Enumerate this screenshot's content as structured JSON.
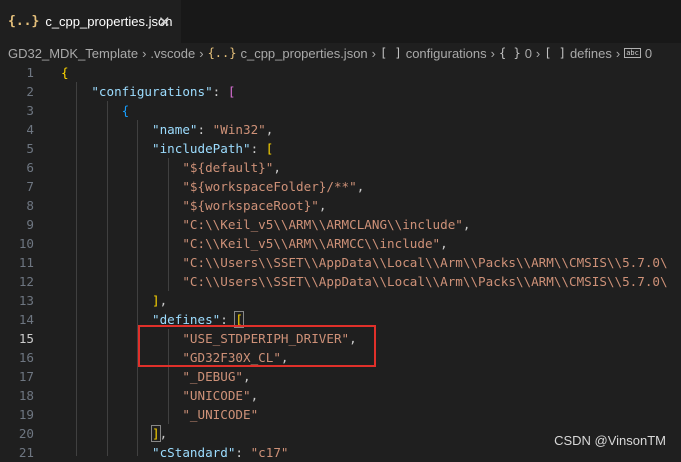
{
  "tab": {
    "icon": "{..}",
    "title": "c_cpp_properties.json",
    "close": "✕"
  },
  "breadcrumb": {
    "items": [
      {
        "icon": "",
        "label": "GD32_MDK_Template"
      },
      {
        "icon": "",
        "label": ".vscode"
      },
      {
        "icon": "{..}",
        "label": "c_cpp_properties.json"
      },
      {
        "icon": "[ ]",
        "label": "configurations"
      },
      {
        "icon": "{ }",
        "label": "0"
      },
      {
        "icon": "[ ]",
        "label": "defines"
      },
      {
        "icon": "abc",
        "label": "0"
      }
    ],
    "separator": "›"
  },
  "lines": [
    {
      "n": "1"
    },
    {
      "n": "2"
    },
    {
      "n": "3"
    },
    {
      "n": "4"
    },
    {
      "n": "5"
    },
    {
      "n": "6"
    },
    {
      "n": "7"
    },
    {
      "n": "8"
    },
    {
      "n": "9"
    },
    {
      "n": "10"
    },
    {
      "n": "11"
    },
    {
      "n": "12"
    },
    {
      "n": "13"
    },
    {
      "n": "14"
    },
    {
      "n": "15"
    },
    {
      "n": "16"
    },
    {
      "n": "17"
    },
    {
      "n": "18"
    },
    {
      "n": "19"
    },
    {
      "n": "20"
    },
    {
      "n": "21"
    }
  ],
  "code": {
    "l1": "{",
    "l2_key": "\"configurations\"",
    "colon": ": ",
    "open_sq": "[",
    "close_sq": "]",
    "l3": "{",
    "l4_key": "\"name\"",
    "l4_val": "\"Win32\"",
    "comma": ",",
    "l5_key": "\"includePath\"",
    "include": [
      "\"${default}\"",
      "\"${workspaceFolder}/**\"",
      "\"${workspaceRoot}\"",
      "\"C:\\\\Keil_v5\\\\ARM\\\\ARMCLANG\\\\include\"",
      "\"C:\\\\Keil_v5\\\\ARM\\\\ARMCC\\\\include\"",
      "\"C:\\\\Users\\\\SSET\\\\AppData\\\\Local\\\\Arm\\\\Packs\\\\ARM\\\\CMSIS\\\\5.7.0\\",
      "\"C:\\\\Users\\\\SSET\\\\AppData\\\\Local\\\\Arm\\\\Packs\\\\ARM\\\\CMSIS\\\\5.7.0\\"
    ],
    "l14_key": "\"defines\"",
    "defines": [
      "\"USE_STDPERIPH_DRIVER\"",
      "\"GD32F30X_CL\"",
      "\"_DEBUG\"",
      "\"UNICODE\"",
      "\"_UNICODE\""
    ],
    "l21_key": "\"cStandard\"",
    "l21_val": "\"c17\""
  },
  "watermark": "CSDN @VinsonTM",
  "colors": {
    "background": "#1f1f1f",
    "key": "#9cdcfe",
    "string": "#ce9178",
    "highlight": "#e0302a"
  }
}
